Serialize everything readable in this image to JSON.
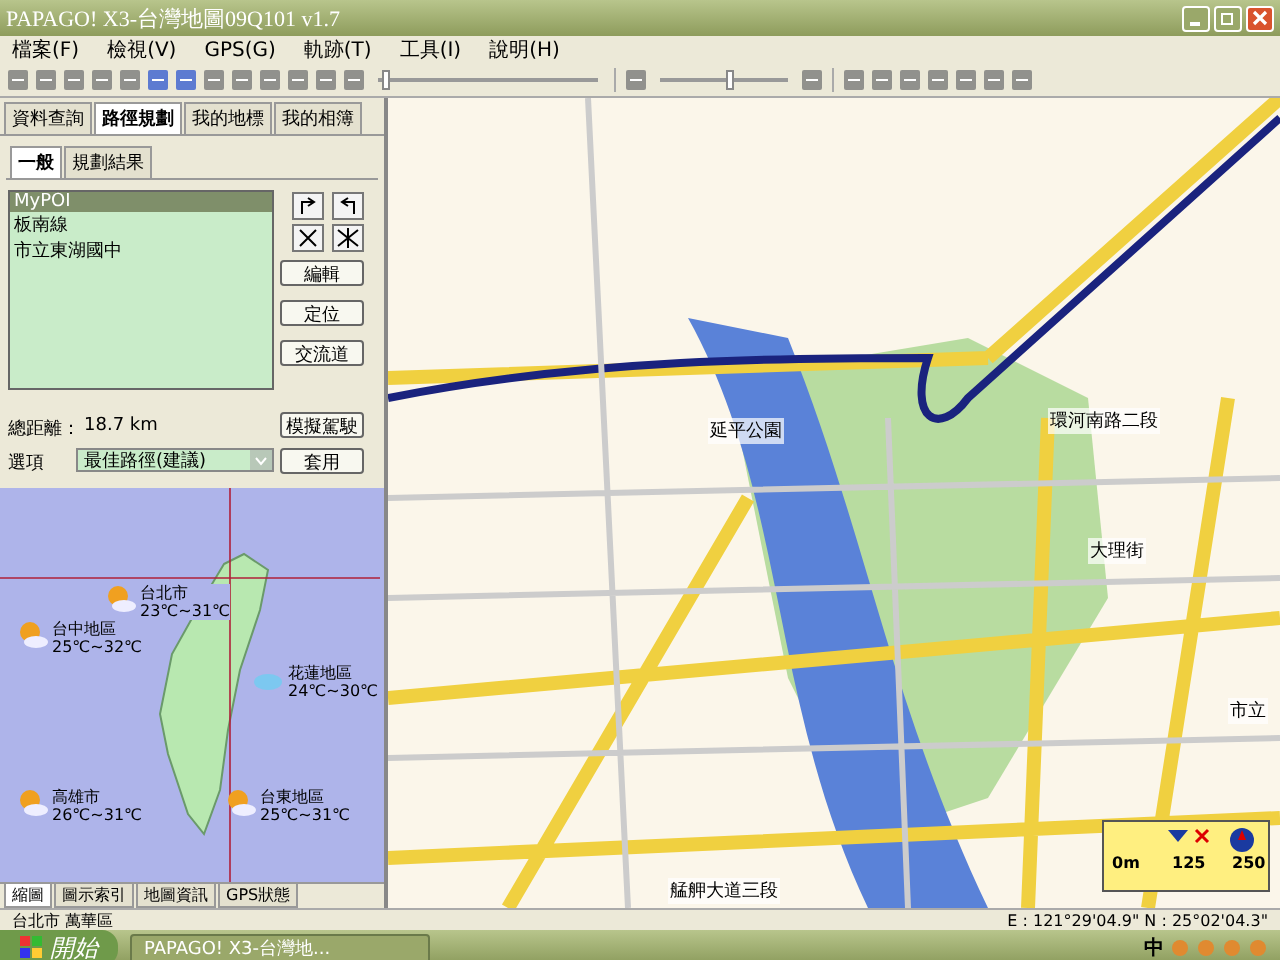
{
  "window": {
    "title": "PAPAGO! X3-台灣地圖09Q101 v1.7"
  },
  "menu": [
    "檔案(F)",
    "檢視(V)",
    "GPS(G)",
    "軌跡(T)",
    "工具(I)",
    "說明(H)"
  ],
  "toolbar": {
    "zoom_slider": {
      "level": 0.55
    },
    "playback_slider": {
      "level": 0.02
    }
  },
  "panel_tabs": [
    {
      "label": "資料查詢",
      "selected": false
    },
    {
      "label": "路徑規劃",
      "selected": true
    },
    {
      "label": "我的地標",
      "selected": false
    },
    {
      "label": "我的相簿",
      "selected": false
    }
  ],
  "sub_tabs": [
    {
      "label": "一般",
      "selected": true
    },
    {
      "label": "規劃結果",
      "selected": false
    }
  ],
  "route_points": [
    {
      "label": "MyPOI",
      "selected": true
    },
    {
      "label": "板南線",
      "selected": false
    },
    {
      "label": "市立東湖國中",
      "selected": false
    }
  ],
  "side_buttons": [
    "編輯",
    "定位",
    "交流道"
  ],
  "total_distance": {
    "label": "總距離：",
    "value": "18.7 km"
  },
  "simulate_button": "模擬駕駛",
  "option": {
    "label": "選項",
    "value": "最佳路徑(建議)"
  },
  "apply_button": "套用",
  "weather": [
    {
      "city": "台北市",
      "temp": "23℃~31℃",
      "kind": "sun"
    },
    {
      "city": "台中地區",
      "temp": "25℃~32℃",
      "kind": "sun"
    },
    {
      "city": "花蓮地區",
      "temp": "24℃~30℃",
      "kind": "cloud"
    },
    {
      "city": "高雄市",
      "temp": "26℃~31℃",
      "kind": "sun"
    },
    {
      "city": "台東地區",
      "temp": "25℃~31℃",
      "kind": "sun"
    }
  ],
  "bottom_tabs": [
    {
      "label": "縮圖",
      "selected": true
    },
    {
      "label": "圖示索引",
      "selected": false
    },
    {
      "label": "地圖資訊",
      "selected": false
    },
    {
      "label": "GPS狀態",
      "selected": false
    }
  ],
  "map_labels": [
    "延平公園",
    "環河南路二段",
    "艋舺大道三段",
    "大理街",
    "市立"
  ],
  "scale": [
    "0m",
    "125",
    "250"
  ],
  "status_bar": {
    "district": "台北市 萬華區",
    "coords": "E : 121°29'04.9\"   N : 25°02'04.3\""
  },
  "taskbar": {
    "start": "開始",
    "task": "PAPAGO! X3-台灣地...",
    "ime": "中"
  }
}
